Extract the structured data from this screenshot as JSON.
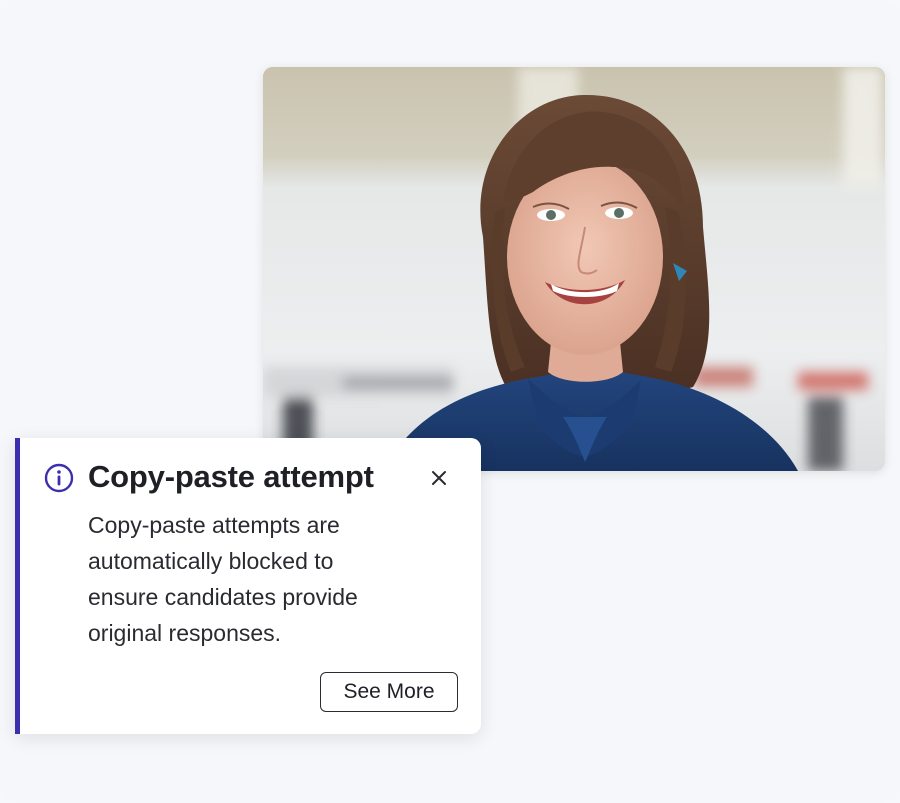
{
  "video": {
    "subject": "smiling woman with bangs in a blue blouse"
  },
  "notification": {
    "icon": "info-icon",
    "title": "Copy-paste attempt",
    "close_icon": "close-icon",
    "message": "Copy-paste attempts are automatically blocked to ensure candidates provide original responses.",
    "button_label": "See More"
  },
  "colors": {
    "accent": "#3b2fb0",
    "background": "#f6f7fa",
    "text": "#1f2025"
  }
}
